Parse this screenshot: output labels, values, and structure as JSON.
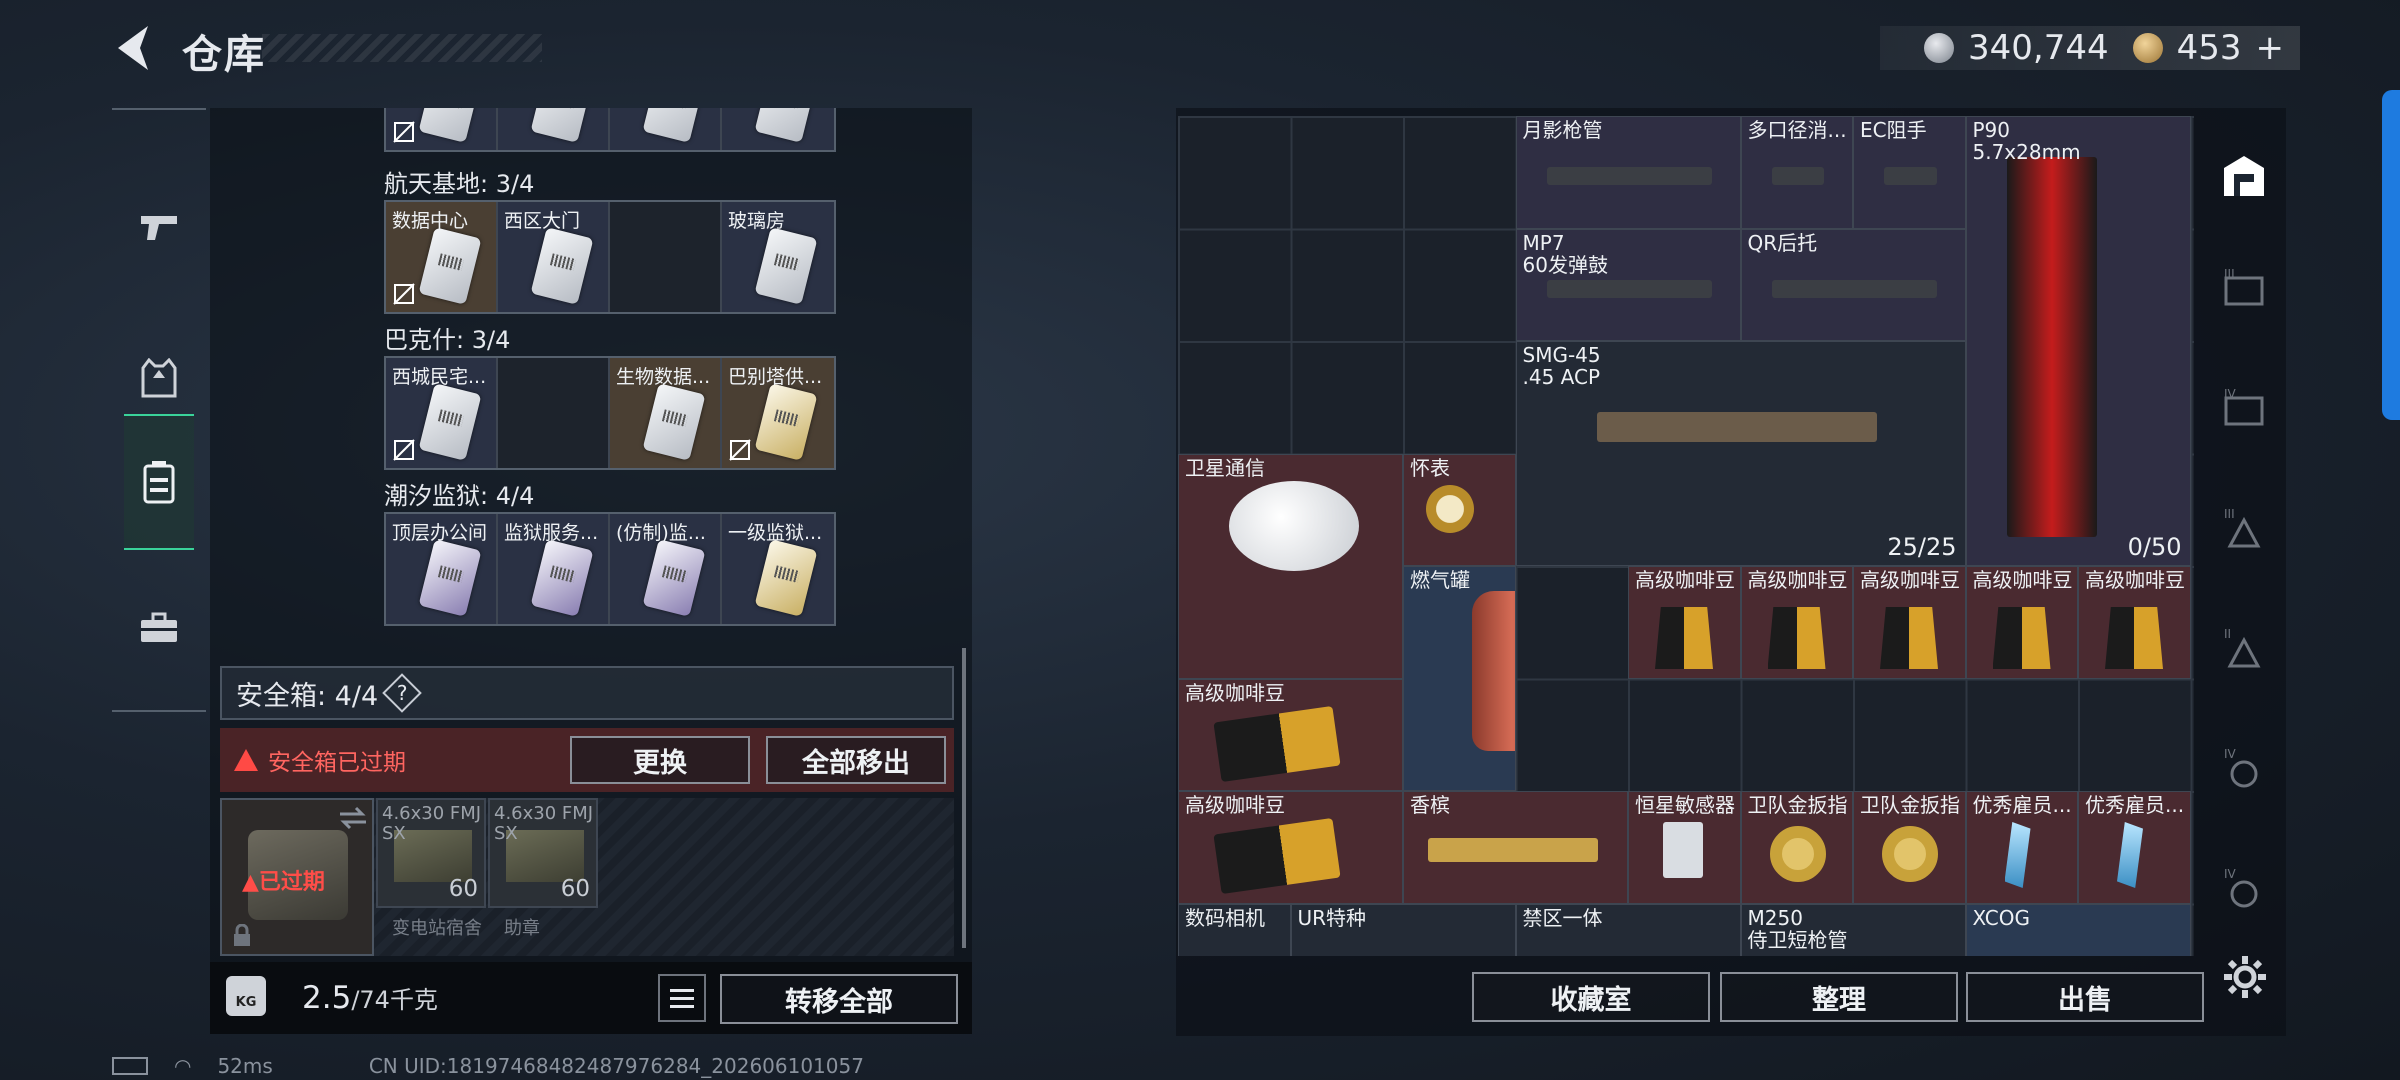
{
  "header": {
    "title": "仓库",
    "silver": "340,744",
    "gold": "453",
    "gold_add": "+"
  },
  "left_sidebar": {
    "tabs": [
      "weapons",
      "armor",
      "backpack",
      "toolbox"
    ],
    "active": 2
  },
  "key_groups": [
    {
      "title": "航天基地: 3/4",
      "slots": [
        {
          "label": "数据中心",
          "style": "gold",
          "card": "white",
          "nobind": true
        },
        {
          "label": "西区大门",
          "style": "blue",
          "card": "white",
          "nobind": false
        },
        {
          "label": "",
          "style": "empty",
          "card": "",
          "nobind": false
        },
        {
          "label": "玻璃房",
          "style": "blue",
          "card": "white",
          "nobind": false
        }
      ]
    },
    {
      "title": "巴克什: 3/4",
      "slots": [
        {
          "label": "西城民宅...",
          "style": "blue",
          "card": "white",
          "nobind": true
        },
        {
          "label": "",
          "style": "empty",
          "card": "",
          "nobind": false
        },
        {
          "label": "生物数据...",
          "style": "gold",
          "card": "white",
          "nobind": false
        },
        {
          "label": "巴别塔供...",
          "style": "gold",
          "card": "yellow",
          "nobind": true
        }
      ]
    },
    {
      "title": "潮汐监狱: 4/4",
      "slots": [
        {
          "label": "顶层办公间",
          "style": "blue",
          "card": "purple",
          "nobind": false
        },
        {
          "label": "监狱服务...",
          "style": "blue",
          "card": "purple",
          "nobind": false
        },
        {
          "label": "(仿制)监...",
          "style": "blue",
          "card": "purple",
          "nobind": false
        },
        {
          "label": "一级监狱...",
          "style": "blue",
          "card": "yellow",
          "nobind": false
        }
      ]
    }
  ],
  "safebox": {
    "title": "安全箱: 4/4",
    "help": "?",
    "warning": "安全箱已过期",
    "replace_btn": "更换",
    "remove_all_btn": "全部移出",
    "expired_tag": "已过期",
    "ammo": [
      {
        "name": "4.6x30 FMJ SX",
        "count": "60"
      },
      {
        "name": "4.6x30 FMJ SX",
        "count": "60"
      }
    ],
    "under_labels": [
      "变电站宿舍",
      "助章"
    ]
  },
  "weight": {
    "current": "2.5",
    "max": "/74千克",
    "kg_label": "KG",
    "transfer_all_btn": "转移全部"
  },
  "stash": {
    "items": [
      {
        "name": "月影枪管",
        "color": "purple"
      },
      {
        "name": "多口径消...",
        "color": "purple"
      },
      {
        "name": "EC阻手",
        "color": "purple"
      },
      {
        "name": "P90\n5.7x28mm",
        "color": "purple",
        "count": "0/50"
      },
      {
        "name": "MP7\n60发弹鼓",
        "color": "purple"
      },
      {
        "name": "QR后托",
        "color": "purple"
      },
      {
        "name": "SMG-45\n.45 ACP",
        "color": "dark",
        "count": "25/25"
      },
      {
        "name": "卫星通信",
        "color": "red"
      },
      {
        "name": "怀表",
        "color": "red"
      },
      {
        "name": "燃气罐",
        "color": "blue"
      },
      {
        "name": "高级咖啡豆",
        "color": "red"
      },
      {
        "name": "香槟",
        "color": "red"
      },
      {
        "name": "恒星敏感器",
        "color": "red"
      },
      {
        "name": "卫队金扳指",
        "color": "red"
      },
      {
        "name": "优秀雇员...",
        "color": "red"
      },
      {
        "name": "数码相机",
        "color": "dark"
      },
      {
        "name": "UR特种",
        "color": "dark"
      },
      {
        "name": "禁区一体",
        "color": "dark"
      },
      {
        "name": "M250\n侍卫短枪管",
        "color": "dark"
      },
      {
        "name": "XCOG",
        "color": "blue"
      }
    ]
  },
  "bottom_buttons": {
    "collection": "收藏室",
    "sort": "整理",
    "sell": "出售"
  },
  "footer": {
    "ping": "52ms",
    "uid": "CN UID:18197468482487976284_202606101057"
  },
  "colors": {
    "accent_green": "#3ad39a",
    "warn_red": "#ff4a45",
    "scroll_blue": "#1e7be0"
  }
}
